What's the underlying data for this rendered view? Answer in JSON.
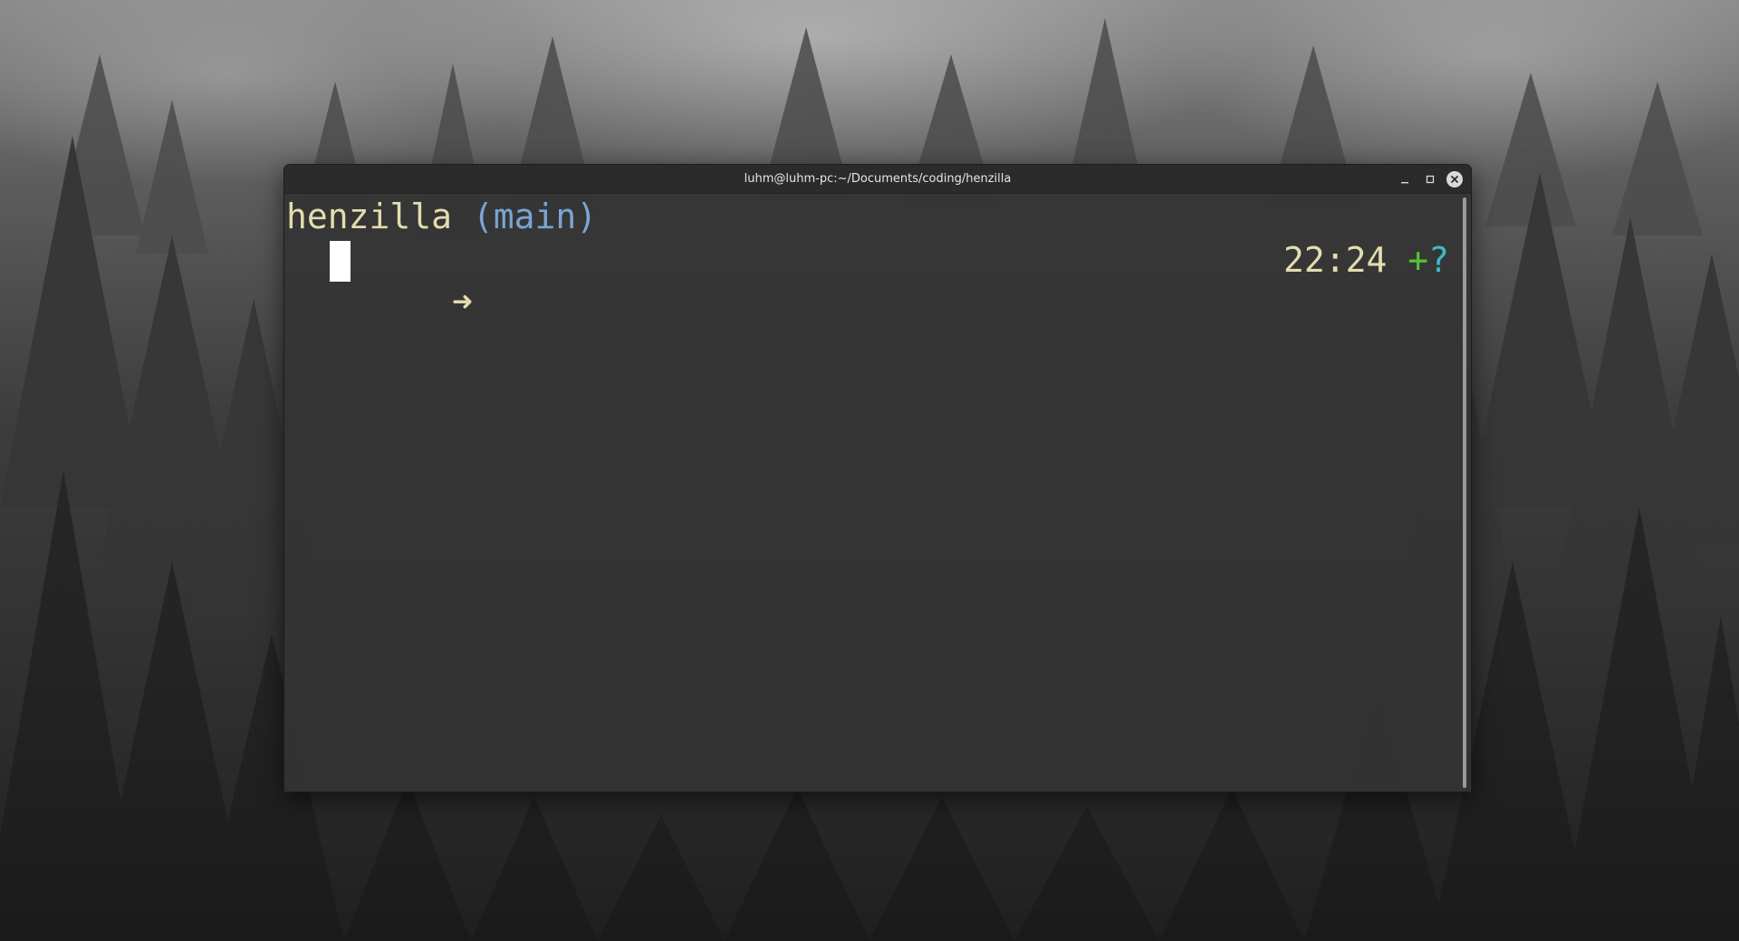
{
  "window": {
    "title": "luhm@luhm-pc:~/Documents/coding/henzilla",
    "buttons": {
      "minimize_icon": "minimize-icon",
      "maximize_icon": "maximize-icon",
      "close_icon": "close-icon"
    }
  },
  "terminal": {
    "prompt_directory": "henzilla",
    "prompt_branch": "(main)",
    "prompt_symbol": "➜",
    "input_value": "",
    "right_prompt": {
      "time": "22:24",
      "git_staged": "+",
      "git_untracked": "?"
    }
  },
  "colors": {
    "directory": "#e3dcae",
    "branch": "#7aa4d4",
    "time": "#e3dcae",
    "git_staged": "#4fc436",
    "git_untracked": "#3fb9c9",
    "terminal_background": "#343434",
    "cursor": "#ffffff"
  }
}
